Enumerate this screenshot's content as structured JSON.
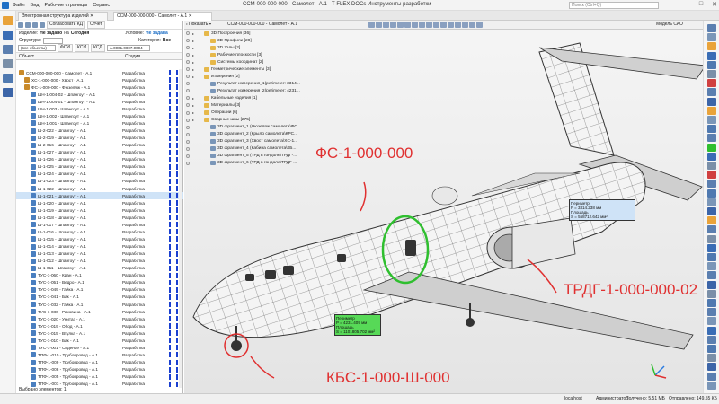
{
  "titlebar": {
    "menu": [
      "Файл",
      "Вид",
      "Рабочие страницы",
      "Сервис"
    ],
    "title": "CCM-000-000-000 - Самолет - A.1 - T-FLEX DOCs Инструменты разработки",
    "search_placeholder": "Поиск (Ctrl+Q)"
  },
  "tabs": [
    {
      "label": "Электронная структура изделий"
    },
    {
      "label": "CCM-000-000-000 - Самолет - A.1"
    }
  ],
  "left_panel": {
    "toolbar": {
      "sync_label": "Согласовать КД",
      "report_label": "Отчет"
    },
    "product_label": "Изделие:",
    "product_value": "Не задано",
    "product_na": "на",
    "product_date": "Сегодня",
    "condition_label": "Условие:",
    "condition_value": "Не задана",
    "structure_label": "Структура:",
    "category_label": "Категория:",
    "category_value": "Все",
    "filter": {
      "objects": "(все объекты)",
      "fsi": "ФСИ",
      "ksi": "КСИ",
      "ksd": "КСД",
      "search": "A.0001.0007.0004"
    },
    "columns": {
      "object": "Объект",
      "stage": "Стадия"
    },
    "rows": [
      {
        "name": "CCM-000-000-000 - Самолет - A.1",
        "stage": "Разработка",
        "asm": true
      },
      {
        "name": "XC-1-000-000 - Хвост - A.1",
        "stage": "Разработка",
        "asm": true
      },
      {
        "name": "ФС-1-000-000 - Фюзеляж - A.1",
        "stage": "Разработка",
        "asm": true
      },
      {
        "name": "ШН-1-004-02 - Шпангоут - A.1",
        "stage": "Разработка"
      },
      {
        "name": "ШН-1-004-01 - Шпангоут - A.1",
        "stage": "Разработка"
      },
      {
        "name": "ШН-1-003 - Шпангоут - A.1",
        "stage": "Разработка"
      },
      {
        "name": "ШН-1-002 - Шпангоут - A.1",
        "stage": "Разработка"
      },
      {
        "name": "ШН-1-001 - Шпангоут - A.1",
        "stage": "Разработка"
      },
      {
        "name": "Ш-2-022 - Шпангоут - A.1",
        "stage": "Разработка"
      },
      {
        "name": "Ш-2-019 - Шпангоут - A.1",
        "stage": "Разработка"
      },
      {
        "name": "Ш-2-016 - Шпангоут - A.1",
        "stage": "Разработка"
      },
      {
        "name": "Ш-1-027 - Шпангоут - A.1",
        "stage": "Разработка"
      },
      {
        "name": "Ш-1-026 - Шпангоут - A.1",
        "stage": "Разработка"
      },
      {
        "name": "Ш-1-025 - Шпангоут - A.1",
        "stage": "Разработка"
      },
      {
        "name": "Ш-1-024 - Шпангоут - A.1",
        "stage": "Разработка"
      },
      {
        "name": "Ш-1-023 - Шпангоут - A.1",
        "stage": "Разработка"
      },
      {
        "name": "Ш-1-022 - Шпангоут - A.1",
        "stage": "Разработка"
      },
      {
        "name": "Ш-1-021 - Шпангоут - A.1",
        "stage": "Разработка",
        "selected": true
      },
      {
        "name": "Ш-1-020 - Шпангоут - A.1",
        "stage": "Разработка"
      },
      {
        "name": "Ш-1-019 - Шпангоут - A.1",
        "stage": "Разработка"
      },
      {
        "name": "Ш-1-018 - Шпангоут - A.1",
        "stage": "Разработка"
      },
      {
        "name": "Ш-1-017 - Шпангоут - A.1",
        "stage": "Разработка"
      },
      {
        "name": "Ш-1-016 - Шпангоут - A.1",
        "stage": "Разработка"
      },
      {
        "name": "Ш-1-015 - Шпангоут - A.1",
        "stage": "Разработка"
      },
      {
        "name": "Ш-1-014 - Шпангоут - A.1",
        "stage": "Разработка"
      },
      {
        "name": "Ш-1-013 - Шпангоут - A.1",
        "stage": "Разработка"
      },
      {
        "name": "Ш-1-012 - Шпангоут - A.1",
        "stage": "Разработка"
      },
      {
        "name": "Ш-1-011 - Шпангоут - A.1",
        "stage": "Разработка"
      },
      {
        "name": "ТУС-1-060 - Кран - A.1",
        "stage": "Разработка"
      },
      {
        "name": "ТУС-1-051 - Ведро - A.1",
        "stage": "Разработка"
      },
      {
        "name": "ТУС-1-049 - Гайка - A.1",
        "stage": "Разработка"
      },
      {
        "name": "ТУС-1-041 - Бак - A.1",
        "stage": "Разработка"
      },
      {
        "name": "ТУС-1-032 - Гайка - A.1",
        "stage": "Разработка"
      },
      {
        "name": "ТУС-1-030 - Раковина - A.1",
        "stage": "Разработка"
      },
      {
        "name": "ТУС-1-020 - Унитаз - A.1",
        "stage": "Разработка"
      },
      {
        "name": "ТУС-1-019 - Обод - A.1",
        "stage": "Разработка"
      },
      {
        "name": "ТУС-1-015 - Втулка - A.1",
        "stage": "Разработка"
      },
      {
        "name": "ТУС-1-010 - Бак - A.1",
        "stage": "Разработка"
      },
      {
        "name": "ТУС-1-001 - Сиденье - A.1",
        "stage": "Разработка"
      },
      {
        "name": "ТПФ-1-010 - Трубопровод - A.1",
        "stage": "Разработка"
      },
      {
        "name": "ТПФ-1-009 - Трубопровод - A.1",
        "stage": "Разработка"
      },
      {
        "name": "ТПФ-1-008 - Трубопровод - A.1",
        "stage": "Разработка"
      },
      {
        "name": "ТПФ-1-005 - Трубопровод - A.1",
        "stage": "Разработка"
      },
      {
        "name": "ТПФ-1-003 - Трубопровод - A.1",
        "stage": "Разработка"
      }
    ],
    "status": "Выбрано элементов: 1"
  },
  "viewport": {
    "tab_label": "CCM-000-000-000 - Самолет - A.1",
    "show_label": "Показать",
    "model_label": "Модель САО",
    "tree": [
      {
        "label": "3D Построения [36]",
        "indent": 0,
        "folder": true
      },
      {
        "label": "3D Профили [28]",
        "indent": 1,
        "folder": true
      },
      {
        "label": "3D Узлы [2]",
        "indent": 1,
        "folder": true
      },
      {
        "label": "Рабочие плоскости [3]",
        "indent": 1,
        "folder": true
      },
      {
        "label": "Системы координат [2]",
        "indent": 1,
        "folder": true
      },
      {
        "label": "Геометрические элементы [3]",
        "indent": 0,
        "folder": true
      },
      {
        "label": "Измерения [2]",
        "indent": 0,
        "folder": true
      },
      {
        "label": "Результат измерения_1(perimeter: 3314...",
        "indent": 1,
        "folder": false
      },
      {
        "label": "Результат измерения_2(perimeter: 4231...",
        "indent": 1,
        "folder": false
      },
      {
        "label": "Кабельные изделия [1]",
        "indent": 0,
        "folder": true
      },
      {
        "label": "Материалы [3]",
        "indent": 0,
        "folder": true
      },
      {
        "label": "Операции [6]",
        "indent": 0,
        "folder": true
      },
      {
        "label": "Сварные швы [275]",
        "indent": 0,
        "folder": true
      },
      {
        "label": "3D фрагмент_1 (Фюзеляж самолета\\ФС...",
        "indent": 1,
        "folder": false
      },
      {
        "label": "3D фрагмент_2 (Крыло самолета\\КРС...",
        "indent": 1,
        "folder": false
      },
      {
        "label": "3D фрагмент_3 (Хвост самолета\\XC-1...",
        "indent": 1,
        "folder": false
      },
      {
        "label": "3D фрагмент_4 (Кабина самолета\\КБ...",
        "indent": 1,
        "folder": false
      },
      {
        "label": "3D фрагмент_5 (ТРД в гондоле\\ТРДГ-...",
        "indent": 1,
        "folder": false
      },
      {
        "label": "3D фрагмент_6 (ТРД в гондоле\\ТРДГ-...",
        "indent": 1,
        "folder": false
      }
    ],
    "annotations": {
      "fuselage": "ФС-1-000-000",
      "engine": "ТРДГ-1-000-000-02",
      "gear": "КБС-1-000-Ш-000"
    },
    "measure1": {
      "l1": "Периметр",
      "l2": "P = 3314.238 мм",
      "l3": "Площадь",
      "l4": "S = 558712.642 мм²"
    },
    "measure2": {
      "l1": "Периметр",
      "l2": "P = 4231.409 мм",
      "l3": "Площадь",
      "l4": "S = 1101805.702 мм²"
    }
  },
  "statusbar": {
    "host": "localhost",
    "user": "Администратор",
    "received": "Получено: 5,51 МБ",
    "sent": "Отправлено: 149,55 КБ"
  },
  "colors": {
    "accent": "#1e6fc5",
    "annotation": "#e03030",
    "stage_bar": "#1a3fd0",
    "selection": "#cfe3f7"
  }
}
